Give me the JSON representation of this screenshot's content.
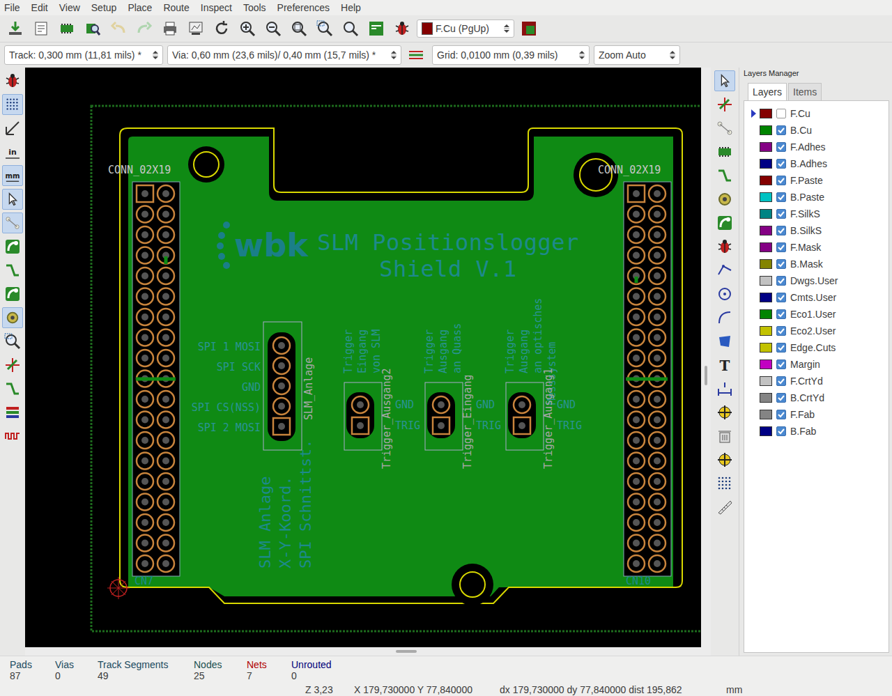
{
  "menu": [
    "File",
    "Edit",
    "View",
    "Setup",
    "Place",
    "Route",
    "Inspect",
    "Tools",
    "Preferences",
    "Help"
  ],
  "top_toolbar": [
    {
      "kind": "save",
      "disabled": false
    },
    {
      "kind": "page",
      "disabled": false
    },
    {
      "kind": "chip",
      "disabled": false
    },
    {
      "kind": "chipzoom",
      "disabled": false
    },
    {
      "kind": "undo",
      "disabled": true
    },
    {
      "kind": "redo",
      "disabled": true
    },
    {
      "kind": "print",
      "disabled": false
    },
    {
      "kind": "plot",
      "disabled": false
    },
    {
      "kind": "redraw",
      "disabled": false
    },
    {
      "kind": "zoomin",
      "disabled": false
    },
    {
      "kind": "zoomout",
      "disabled": false
    },
    {
      "kind": "zoomfit",
      "disabled": false
    },
    {
      "kind": "zoomarea",
      "disabled": false
    },
    {
      "kind": "find",
      "disabled": false
    },
    {
      "kind": "netlist",
      "disabled": false
    },
    {
      "kind": "bug",
      "disabled": false
    }
  ],
  "layer_select": {
    "label": "F.Cu (PgUp)"
  },
  "options_bar": {
    "track": "Track: 0,300 mm (11,81 mils) *",
    "via": "Via: 0,60 mm (23,6 mils)/ 0,40 mm (15,7 mils) *",
    "grid": "Grid: 0,0100 mm (0,39 mils)",
    "zoom": "Zoom Auto"
  },
  "left_toolbar": [
    {
      "kind": "bug",
      "label": "",
      "selected": false
    },
    {
      "kind": "grid",
      "label": "",
      "selected": true
    },
    {
      "kind": "ruler",
      "label": "",
      "selected": false
    },
    {
      "kind": "unit",
      "label": "in",
      "selected": false
    },
    {
      "kind": "unit",
      "label": "mm",
      "selected": true
    },
    {
      "kind": "cursor",
      "label": "",
      "selected": true
    },
    {
      "kind": "ratsnest",
      "label": "",
      "selected": true
    },
    {
      "kind": "net",
      "label": "",
      "selected": false
    },
    {
      "kind": "track",
      "label": "",
      "selected": false
    },
    {
      "kind": "net",
      "label": "",
      "selected": false
    },
    {
      "kind": "pad",
      "label": "",
      "selected": true
    },
    {
      "kind": "zoomarea",
      "label": "",
      "selected": false
    },
    {
      "kind": "cross",
      "label": "",
      "selected": false
    },
    {
      "kind": "track",
      "label": "",
      "selected": false
    },
    {
      "kind": "layers",
      "label": "",
      "selected": false
    },
    {
      "kind": "wave",
      "label": "",
      "selected": false
    }
  ],
  "right_toolbar": [
    {
      "kind": "arrow",
      "label": "",
      "selected": true
    },
    {
      "kind": "cross",
      "label": "",
      "selected": false
    },
    {
      "kind": "ratsnest",
      "label": "",
      "selected": false
    },
    {
      "kind": "chip",
      "label": "",
      "selected": false
    },
    {
      "kind": "track",
      "label": "",
      "selected": false
    },
    {
      "kind": "pad",
      "label": "",
      "selected": false
    },
    {
      "kind": "net",
      "label": "",
      "selected": false
    },
    {
      "kind": "bug",
      "label": "",
      "selected": false
    },
    {
      "kind": "line",
      "label": "",
      "selected": false
    },
    {
      "kind": "circle",
      "label": "",
      "selected": false
    },
    {
      "kind": "arc",
      "label": "",
      "selected": false
    },
    {
      "kind": "polygon",
      "label": "",
      "selected": false
    },
    {
      "kind": "text",
      "label": "T",
      "selected": false
    },
    {
      "kind": "dimension",
      "label": "",
      "selected": false
    },
    {
      "kind": "target",
      "label": "",
      "selected": false
    },
    {
      "kind": "trash",
      "label": "",
      "selected": false
    },
    {
      "kind": "target",
      "label": "",
      "selected": false
    },
    {
      "kind": "grid",
      "label": "",
      "selected": false
    },
    {
      "kind": "measure",
      "label": "",
      "selected": false
    }
  ],
  "pcb": {
    "logo": "wbk",
    "title": [
      "SLM Positionslogger",
      "Shield V.1"
    ],
    "connectors": [
      {
        "ref": "CN7",
        "value": "CONN_02X19",
        "pin_rows": 19
      },
      {
        "ref": "CN10",
        "value": "CONN_02X19",
        "pin_rows": 19
      }
    ],
    "slm_connector": {
      "ref": "SLM_Anlage",
      "pins": [
        "SPI 1 MOSI",
        "SPI SCK",
        "GND",
        "SPI CS(NSS)",
        "SPI 2 MOSI"
      ]
    },
    "trigger_connectors": [
      {
        "ref": "Trigger_Ausgang2",
        "description": [
          "Trigger",
          "Eingang",
          "von SLM"
        ],
        "pins": [
          "GND",
          "TRIG"
        ]
      },
      {
        "ref": "Trigger_Eingang",
        "description": [
          "Trigger",
          "Ausgang",
          "an Quass"
        ],
        "pins": [
          "GND",
          "TRIG"
        ]
      },
      {
        "ref": "Trigger_Ausgang1",
        "description": [
          "Trigger",
          "Ausgang",
          "an optisches",
          "Messsystem"
        ],
        "pins": [
          "GND",
          "TRIG"
        ]
      }
    ],
    "side_note": [
      "SLM Anlage",
      "X-Y-Koord.",
      "SPI Schnittst."
    ]
  },
  "layers_panel": {
    "title": "Layers Manager",
    "tabs": [
      {
        "label": "Layers",
        "selected": true
      },
      {
        "label": "Items",
        "selected": false
      }
    ],
    "layers": [
      {
        "name": "F.Cu",
        "color": "#840000",
        "visible": false,
        "active": true
      },
      {
        "name": "B.Cu",
        "color": "#008400",
        "visible": true,
        "active": false
      },
      {
        "name": "F.Adhes",
        "color": "#840084",
        "visible": true,
        "active": false
      },
      {
        "name": "B.Adhes",
        "color": "#000084",
        "visible": true,
        "active": false
      },
      {
        "name": "F.Paste",
        "color": "#840000",
        "visible": true,
        "active": false
      },
      {
        "name": "B.Paste",
        "color": "#00c2c2",
        "visible": true,
        "active": false
      },
      {
        "name": "F.SilkS",
        "color": "#008484",
        "visible": true,
        "active": false
      },
      {
        "name": "B.SilkS",
        "color": "#840084",
        "visible": true,
        "active": false
      },
      {
        "name": "F.Mask",
        "color": "#840084",
        "visible": true,
        "active": false
      },
      {
        "name": "B.Mask",
        "color": "#848400",
        "visible": true,
        "active": false
      },
      {
        "name": "Dwgs.User",
        "color": "#c2c2c2",
        "visible": true,
        "active": false
      },
      {
        "name": "Cmts.User",
        "color": "#000084",
        "visible": true,
        "active": false
      },
      {
        "name": "Eco1.User",
        "color": "#008400",
        "visible": true,
        "active": false
      },
      {
        "name": "Eco2.User",
        "color": "#c2c200",
        "visible": true,
        "active": false
      },
      {
        "name": "Edge.Cuts",
        "color": "#c2c200",
        "visible": true,
        "active": false
      },
      {
        "name": "Margin",
        "color": "#c200c2",
        "visible": true,
        "active": false
      },
      {
        "name": "F.CrtYd",
        "color": "#c2c2c2",
        "visible": true,
        "active": false
      },
      {
        "name": "B.CrtYd",
        "color": "#848484",
        "visible": true,
        "active": false
      },
      {
        "name": "F.Fab",
        "color": "#848484",
        "visible": true,
        "active": false
      },
      {
        "name": "B.Fab",
        "color": "#000084",
        "visible": true,
        "active": false
      }
    ]
  },
  "status_bar": {
    "counts": [
      {
        "label": "Pads",
        "value": "87",
        "color": "#1a4a5e"
      },
      {
        "label": "Vias",
        "value": "0",
        "color": "#1a4a5e"
      },
      {
        "label": "Track Segments",
        "value": "49",
        "color": "#1a4a5e"
      },
      {
        "label": "Nodes",
        "value": "25",
        "color": "#1a5050"
      },
      {
        "label": "Nets",
        "value": "7",
        "color": "#b00000"
      },
      {
        "label": "Unrouted",
        "value": "0",
        "color": "#00007a"
      }
    ],
    "zoom": "Z 3,23",
    "position": "X 179,730000  Y 77,840000",
    "delta": "dx 179,730000  dy 77,840000  dist 195,862",
    "units": "mm"
  }
}
